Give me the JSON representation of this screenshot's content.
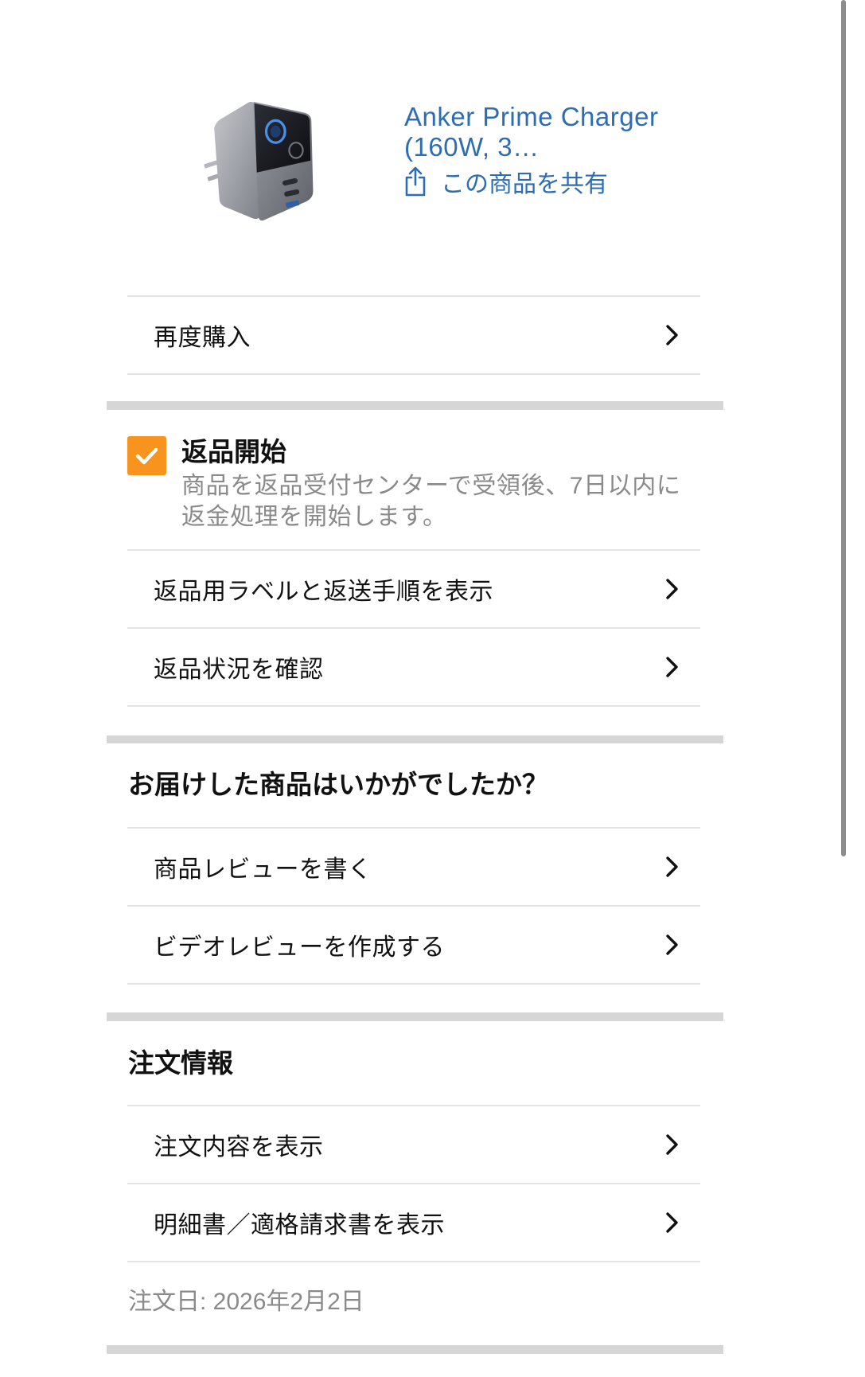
{
  "theme": {
    "accent_color": "#f8941e",
    "link_color": "#2d6db5",
    "text_color": "#111111",
    "muted_color": "#8a8a8a",
    "divider_color": "#e3e3e3",
    "band_color": "#d6d6d6"
  },
  "product": {
    "image_icon": "charger-product-image",
    "title_lines": [
      "Anker Prime Charger",
      "(160W, 3…"
    ],
    "share": {
      "icon": "share-icon",
      "label": "この商品を共有"
    }
  },
  "buy_again": {
    "label": "再度購入",
    "icon": "chevron-right-icon"
  },
  "return_status": {
    "checked": true,
    "icon": "checkmark-icon",
    "title": "返品開始",
    "description_lines": [
      "商品を返品受付センターで受領後、7日以内に",
      "返金処理を開始します。"
    ],
    "links": [
      {
        "label": "返品用ラベルと返送手順を表示"
      },
      {
        "label": "返品状況を確認"
      }
    ]
  },
  "review": {
    "title": "お届けした商品はいかがでしたか？",
    "links": [
      {
        "label": "商品レビューを書く"
      },
      {
        "label": "ビデオレビューを作成する"
      }
    ]
  },
  "order_info": {
    "title": "注文情報",
    "links": [
      {
        "label": "注文内容を表示"
      },
      {
        "label": "明細書／適格請求書を表示"
      }
    ],
    "order_date": "注文日: 2026年2月2日"
  }
}
